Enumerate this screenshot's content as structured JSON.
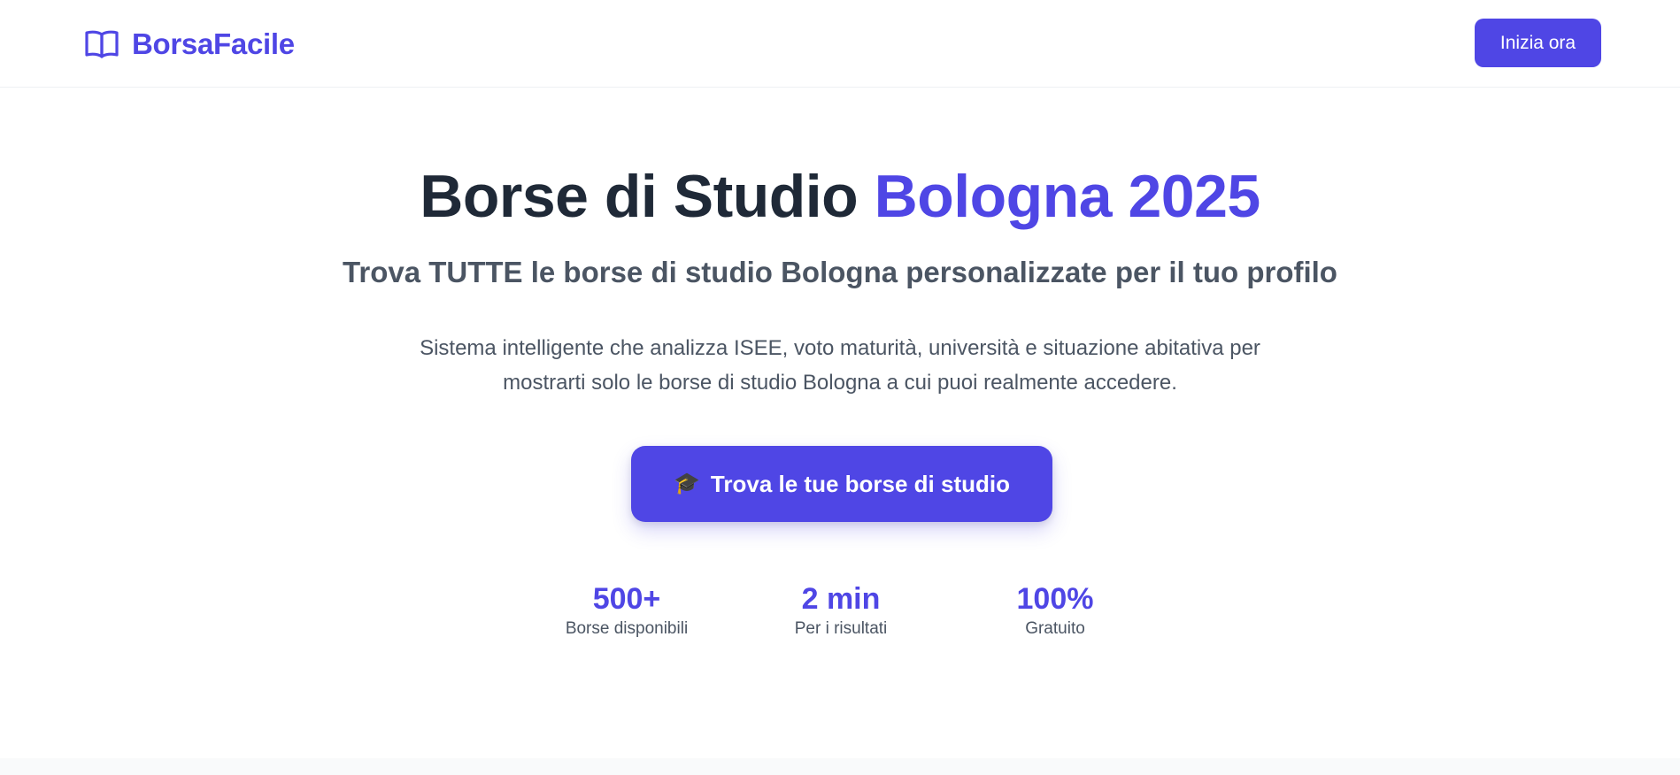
{
  "header": {
    "brand": "BorsaFacile",
    "logo_icon": "open-book-icon",
    "cta_label": "Inizia ora"
  },
  "hero": {
    "title_main": "Borse di Studio ",
    "title_accent": "Bologna 2025",
    "subtitle": "Trova TUTTE le borse di studio Bologna personalizzate per il tuo profilo",
    "description": "Sistema intelligente che analizza ISEE, voto maturità, università e situazione abitativa per mostrarti solo le borse di studio Bologna a cui puoi realmente accedere.",
    "cta_icon": "🎓",
    "cta_label": "Trova le tue borse di studio"
  },
  "stats": [
    {
      "value": "500+",
      "label": "Borse disponibili"
    },
    {
      "value": "2 min",
      "label": "Per i risultati"
    },
    {
      "value": "100%",
      "label": "Gratuito"
    }
  ],
  "colors": {
    "accent": "#4f46e5",
    "heading": "#1f2937",
    "muted": "#4b5563"
  }
}
